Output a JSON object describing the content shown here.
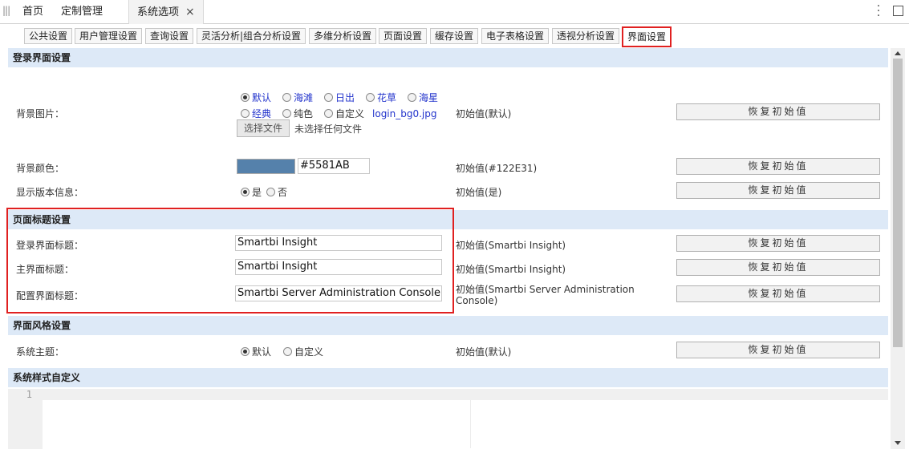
{
  "top_tabs": [
    {
      "label": "首页"
    },
    {
      "label": "定制管理"
    },
    {
      "label": "系统选项",
      "close": "×"
    }
  ],
  "sub_tabs": [
    "公共设置",
    "用户管理设置",
    "查询设置",
    "灵活分析|组合分析设置",
    "多维分析设置",
    "页面设置",
    "缓存设置",
    "电子表格设置",
    "透视分析设置",
    "界面设置"
  ],
  "sections": {
    "login": "登录界面设置",
    "title": "页面标题设置",
    "style": "界面风格设置",
    "custom": "系统样式自定义"
  },
  "bg_image": {
    "label": "背景图片：",
    "options_row1": [
      "默认",
      "海滩",
      "日出",
      "花草",
      "海星"
    ],
    "options_row2": [
      "经典",
      "纯色",
      "自定义"
    ],
    "custom_file": "login_bg0.jpg",
    "file_button": "选择文件",
    "file_status": "未选择任何文件",
    "initial": "初始值(默认)",
    "selected": "默认"
  },
  "bg_color": {
    "label": "背景颜色：",
    "value": "#5581AB",
    "swatch": "#5581AB",
    "initial": "初始值(#122E31)"
  },
  "show_version": {
    "label": "显示版本信息：",
    "yes": "是",
    "no": "否",
    "initial": "初始值(是)"
  },
  "titles": [
    {
      "label": "登录界面标题：",
      "value": "Smartbi Insight",
      "initial": "初始值(Smartbi Insight)"
    },
    {
      "label": "主界面标题：",
      "value": "Smartbi Insight",
      "initial": "初始值(Smartbi Insight)"
    },
    {
      "label": "配置界面标题：",
      "value": "Smartbi Server Administration Console",
      "initial_line1": "初始值(Smartbi Server Administration",
      "initial_line2": "Console)"
    }
  ],
  "theme": {
    "label": "系统主题：",
    "opt_default": "默认",
    "opt_custom": "自定义",
    "initial": "初始值(默认)"
  },
  "reset_label": "恢复初始值",
  "editor": {
    "line_number": "1"
  },
  "colors": {
    "highlight": "#e02020",
    "section_bg": "#dde9f7",
    "link": "#2233cc"
  }
}
